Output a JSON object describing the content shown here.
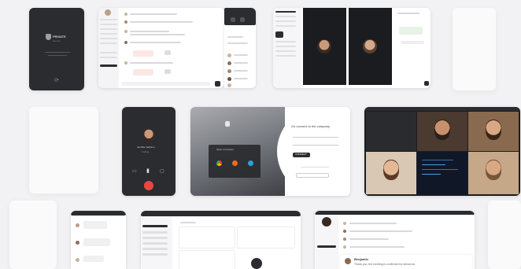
{
  "colors": {
    "accent": "#e8483f",
    "dark": "#2b2c30",
    "blue": "#2d6fd1",
    "green": "#3aa655",
    "orange": "#f26b1d"
  },
  "lock_screen": {
    "brand": "PRIVATE",
    "sub_lines": [
      "Secure",
      "messenger"
    ]
  },
  "login": {
    "heading": "Go connect to the company",
    "button_label": "CONNECT",
    "browser_prompt": "Open in browser"
  },
  "call": {
    "caller": "Jennifer Jackson",
    "status": "Calling..."
  },
  "chat": {
    "sender": "Benjamin",
    "message": "Thank you, the meeting is confirmed for tomorrow"
  }
}
